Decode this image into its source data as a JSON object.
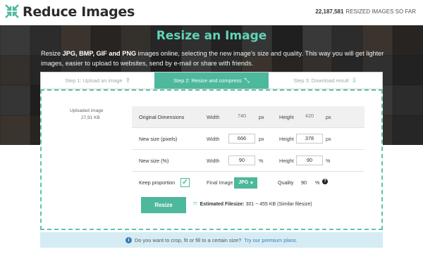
{
  "header": {
    "logo_text": "Reduce Images",
    "counter_value": "22,187,581",
    "counter_label": "RESIZED IMAGES SO FAR"
  },
  "hero": {
    "title": "Resize an Image",
    "desc_prefix": "Resize ",
    "desc_formats": "JPG, BMP, GIF and PNG",
    "desc_suffix": " images online, selecting the new image's size and quality. This way you will get lighter images, easier to upload to websites, send by e-mail or share with friends."
  },
  "steps": [
    {
      "label": "Step 1: Upload an image",
      "icon": "upload-icon"
    },
    {
      "label": "Step 2: Resize and compress",
      "icon": "compress-icon"
    },
    {
      "label": "Step 3: Download result",
      "icon": "download-icon"
    }
  ],
  "uploaded": {
    "label": "Uploaded image",
    "size": "27,91 KB"
  },
  "form": {
    "original": {
      "label": "Original Dimensions",
      "width_label": "Width",
      "width": "740",
      "width_unit": "px",
      "height_label": "Height",
      "height": "420",
      "height_unit": "px"
    },
    "pixels": {
      "label": "New size (pixels)",
      "width_label": "Width",
      "width": "666",
      "width_unit": "px",
      "height_label": "Height",
      "height": "378",
      "height_unit": "px"
    },
    "percent": {
      "label": "New size (%)",
      "width_label": "Width",
      "width": "90",
      "width_unit": "%",
      "height_label": "Height",
      "height": "90",
      "height_unit": "%"
    },
    "options": {
      "keep_label": "Keep proportion",
      "keep_checked": true,
      "final_label": "Final Image",
      "format": "JPG",
      "quality_label": "Quality",
      "quality": "90",
      "quality_unit": "%"
    }
  },
  "actions": {
    "resize_label": "Resize",
    "est_label": "Estimated Filesize:",
    "est_value": " 301 ~ 455 KB (Similar filesize)"
  },
  "promo": {
    "text": "Do you want to crop, fit or fill to a certain size?",
    "link": "Try our premium plans."
  },
  "colors": {
    "accent": "#4db89c",
    "info": "#3d7bb5",
    "hero_title": "#5fd3b8"
  }
}
